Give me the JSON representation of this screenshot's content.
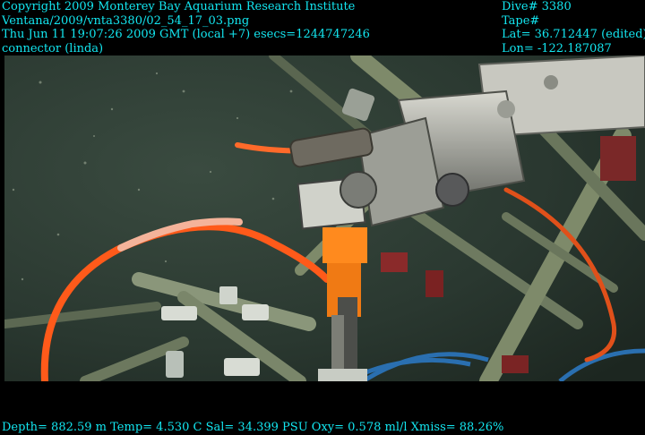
{
  "overlay": {
    "top_left": [
      "Copyright 2009 Monterey Bay Aquarium Research Institute",
      "Ventana/2009/vnta3380/02_54_17_03.png",
      "Thu Jun 11 19:07:26 2009 GMT (local +7)  esecs=1244747246",
      "connector (linda)"
    ],
    "top_right": [
      "Dive# 3380",
      "Tape#",
      "Lat= 36.712447 (edited)",
      "Lon= -122.187087"
    ],
    "bottom": "Depth= 882.59 m  Temp= 4.530 C  Sal= 34.399 PSU  Oxy= 0.578 ml/l  Xmiss= 88.26%"
  },
  "colors": {
    "overlay_text": "#13e6f0",
    "water": "#2c3b32",
    "cable": "#ff5a1a",
    "frame": "#8c9a7a",
    "connector": "#ff8a1e"
  }
}
